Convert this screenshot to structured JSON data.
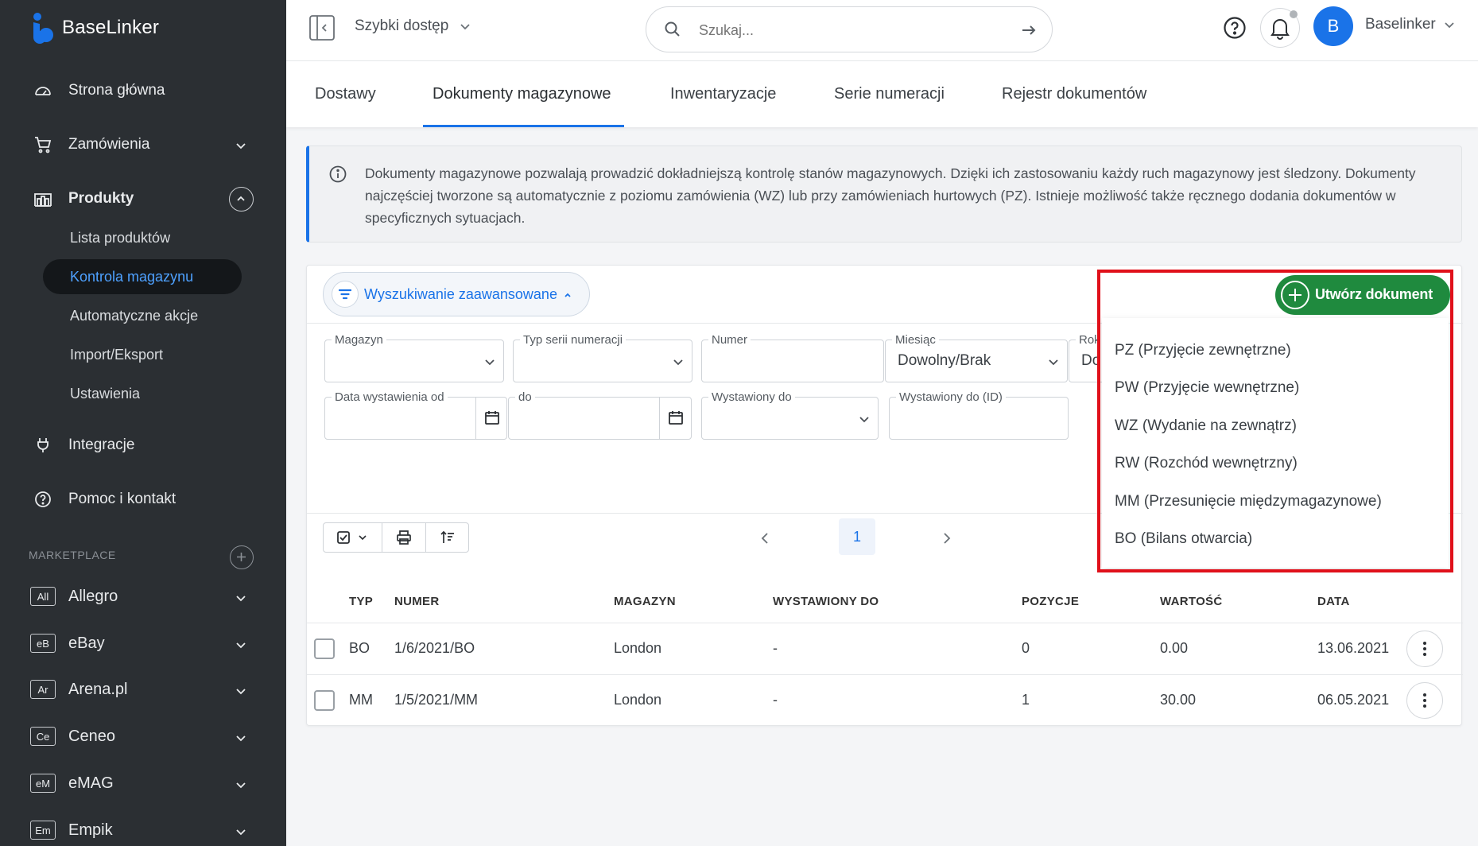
{
  "app": {
    "brand": "BaseLinker",
    "accent": "#1a73e8",
    "success": "#1f8a3e",
    "highlight": "#e0101a"
  },
  "sidebar": {
    "items": [
      {
        "label": "Strona główna",
        "icon": "dashboard-icon"
      },
      {
        "label": "Zamówienia",
        "icon": "cart-icon"
      },
      {
        "label": "Produkty",
        "icon": "warehouse-icon"
      },
      {
        "label": "Integracje",
        "icon": "plug-icon"
      },
      {
        "label": "Pomoc i kontakt",
        "icon": "help-icon"
      }
    ],
    "products_sub": [
      "Lista produktów",
      "Kontrola magazynu",
      "Automatyczne akcje",
      "Import/Eksport",
      "Ustawienia"
    ],
    "active_sub": "Kontrola magazynu",
    "marketplace_title": "MARKETPLACE",
    "marketplaces": [
      {
        "badge": "All",
        "label": "Allegro"
      },
      {
        "badge": "eB",
        "label": "eBay"
      },
      {
        "badge": "Ar",
        "label": "Arena.pl"
      },
      {
        "badge": "Ce",
        "label": "Ceneo"
      },
      {
        "badge": "eM",
        "label": "eMAG"
      },
      {
        "badge": "Em",
        "label": "Empik"
      }
    ]
  },
  "topbar": {
    "quick_access": "Szybki dostęp",
    "search_placeholder": "Szukaj...",
    "avatar_letter": "B",
    "user": "Baselinker"
  },
  "tabs": [
    "Dostawy",
    "Dokumenty magazynowe",
    "Inwentaryzacje",
    "Serie numeracji",
    "Rejestr dokumentów"
  ],
  "active_tab": "Dokumenty magazynowe",
  "info": {
    "text": "Dokumenty magazynowe pozwalają prowadzić dokładniejszą kontrolę stanów magazynowych. Dzięki ich zastosowaniu każdy ruch magazynowy jest śledzony. Dokumenty najczęściej tworzone są automatycznie z poziomu zamówienia (WZ) lub przy zamówieniach hurtowych (PZ). Istnieje możliwość także ręcznego dodania dokumentów w specyficznych sytuacjach."
  },
  "filters": {
    "advanced_label": "Wyszukiwanie zaawansowane",
    "magazyn": "Magazyn",
    "typ_serii": "Typ serii numeracji",
    "numer": "Numer",
    "miesiac": "Miesiąc",
    "miesiac_value": "Dowolny/Brak",
    "rok": "Rok",
    "rok_value": "Do",
    "data_od": "Data wystawienia od",
    "do": "do",
    "wystawiony_do": "Wystawiony do",
    "wystawiony_do_id": "Wystawiony do (ID)"
  },
  "pagination": {
    "current": "1"
  },
  "table": {
    "columns": [
      "TYP",
      "NUMER",
      "MAGAZYN",
      "WYSTAWIONY DO",
      "POZYCJE",
      "WARTOŚĆ",
      "DATA"
    ],
    "rows": [
      {
        "typ": "BO",
        "numer": "1/6/2021/BO",
        "magazyn": "London",
        "wystawiony": "-",
        "pozycje": "0",
        "wartosc": "0.00",
        "data": "13.06.2021"
      },
      {
        "typ": "MM",
        "numer": "1/5/2021/MM",
        "magazyn": "London",
        "wystawiony": "-",
        "pozycje": "1",
        "wartosc": "30.00",
        "data": "06.05.2021"
      }
    ]
  },
  "create": {
    "button_label": "Utwórz dokument",
    "options": [
      "PZ (Przyjęcie zewnętrzne)",
      "PW (Przyjęcie wewnętrzne)",
      "WZ (Wydanie na zewnątrz)",
      "RW (Rozchód wewnętrzny)",
      "MM (Przesunięcie międzymagazynowe)",
      "BO (Bilans otwarcia)"
    ]
  }
}
